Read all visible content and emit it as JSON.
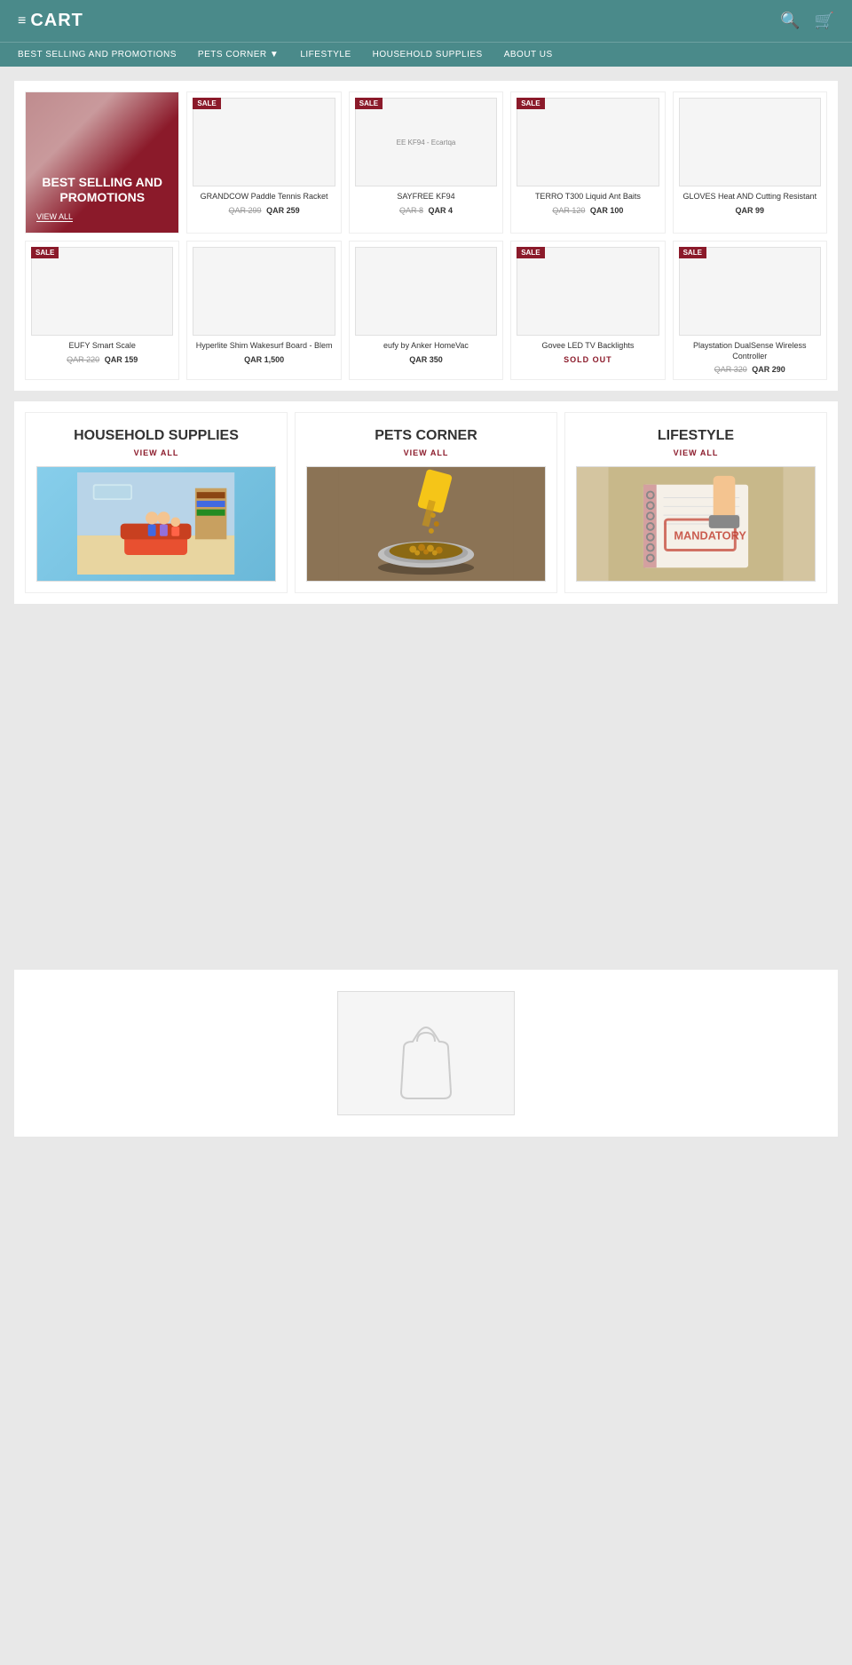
{
  "header": {
    "logo": "≡CART",
    "logo_icon": "≡",
    "logo_text": "CART",
    "search_icon": "🔍",
    "cart_icon": "🛒"
  },
  "nav": {
    "items": [
      {
        "label": "BEST SELLING AND PROMOTIONS",
        "id": "best-selling"
      },
      {
        "label": "PETS CORNER",
        "id": "pets-corner",
        "has_dropdown": true
      },
      {
        "label": "LIFESTYLE",
        "id": "lifestyle"
      },
      {
        "label": "HOUSEHOLD SUPPLIES",
        "id": "household-supplies"
      },
      {
        "label": "ABOUT US",
        "id": "about-us"
      }
    ]
  },
  "hero": {
    "title": "BEST SELLING AND PROMOTIONS",
    "link_label": "VIEW ALL"
  },
  "products_row1": [
    {
      "id": "grandcow-paddle",
      "name": "GRANDCOW Paddle Tennis Racket",
      "original_price": "QAR 299",
      "sale_price": "QAR 259",
      "on_sale": true
    },
    {
      "id": "sayfree-kf94",
      "name": "SAYFREE KF94",
      "original_price": "QAR 8",
      "sale_price": "QAR 4",
      "on_sale": true,
      "badge_text": "EE KF94 - Ecartqa"
    },
    {
      "id": "terro-t300",
      "name": "TERRO T300 Liquid Ant Baits",
      "original_price": "QAR 120",
      "sale_price": "QAR 100",
      "on_sale": true
    },
    {
      "id": "gloves-heat",
      "name": "GLOVES Heat AND Cutting Resistant",
      "price": "QAR 99",
      "on_sale": false
    }
  ],
  "products_row2": [
    {
      "id": "eufy-scale",
      "name": "EUFY Smart Scale",
      "original_price": "QAR 220",
      "sale_price": "QAR 159",
      "on_sale": true
    },
    {
      "id": "hyperlite-wakesurf",
      "name": "Hyperlite Shim Wakesurf Board - Blem",
      "price": "QAR 1,500",
      "on_sale": false
    },
    {
      "id": "eufy-homevac",
      "name": "eufy by Anker HomeVac",
      "price": "QAR 350",
      "on_sale": false
    },
    {
      "id": "govee-led",
      "name": "Govee LED TV Backlights",
      "original_price": "",
      "sale_price": "",
      "on_sale": true,
      "sold_out": true,
      "sold_out_text": "SOLD OUT"
    },
    {
      "id": "playstation-dualsense",
      "name": "Playstation DualSense Wireless Controller",
      "original_price": "QAR 320",
      "sale_price": "QAR 290",
      "on_sale": true
    }
  ],
  "categories": [
    {
      "id": "household-supplies",
      "title": "HOUSEHOLD SUPPLIES",
      "view_all": "VIEW ALL"
    },
    {
      "id": "pets-corner",
      "title": "PETS CORNER",
      "view_all": "VIEW ALL"
    },
    {
      "id": "lifestyle",
      "title": "LIFESTYLE",
      "view_all": "VIEW ALL"
    }
  ],
  "labels": {
    "sale": "SALE",
    "view_all": "VIEW ALL",
    "sold_out": "SOLD OUT"
  }
}
